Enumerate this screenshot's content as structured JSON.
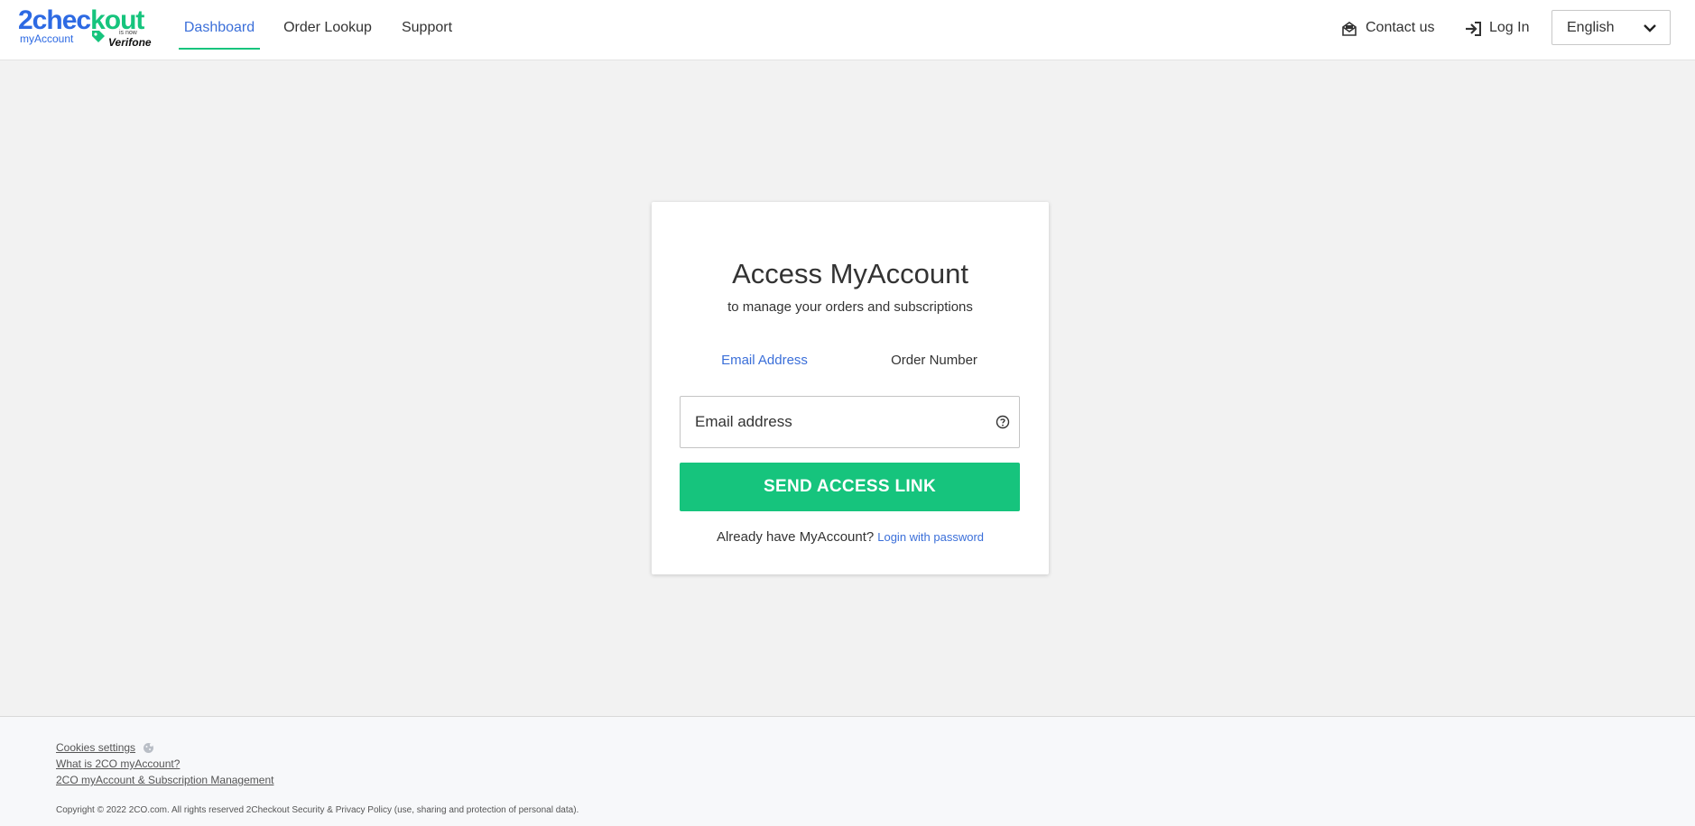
{
  "header": {
    "logo": {
      "brand_part1": "2chec",
      "brand_part2": "kout",
      "sub": "myAccount",
      "is_now": "is now",
      "partner": "Verifone"
    },
    "nav_tabs": [
      {
        "label": "Dashboard",
        "active": true
      },
      {
        "label": "Order Lookup",
        "active": false
      },
      {
        "label": "Support",
        "active": false
      }
    ],
    "contact_label": "Contact us",
    "login_label": "Log In",
    "language_selected": "English"
  },
  "card": {
    "title": "Access MyAccount",
    "subtitle": "to manage your orders and subscriptions",
    "tabs": [
      {
        "label": "Email Address",
        "active": true
      },
      {
        "label": "Order Number",
        "active": false
      }
    ],
    "email_placeholder": "Email address",
    "send_button": "SEND ACCESS LINK",
    "already_text": "Already have MyAccount?",
    "login_link": "Login with password"
  },
  "footer": {
    "links": [
      "Cookies settings",
      "What is 2CO myAccount?",
      "2CO myAccount & Subscription Management"
    ],
    "copyright": "Copyright © 2022 2CO.com. All rights reserved 2Checkout Security & Privacy Policy (use, sharing and protection of personal data)."
  },
  "colors": {
    "brand_blue": "#2d6ae3",
    "brand_green": "#16c47d",
    "link_blue": "#3b6fd9",
    "background": "#f2f2f2"
  },
  "icons": {
    "contact": "envelope-open-icon",
    "login": "sign-in-icon",
    "language": "chevron-down-icon",
    "help": "question-circle-icon",
    "cookie": "cookie-icon",
    "logo_tag": "tag-icon"
  }
}
